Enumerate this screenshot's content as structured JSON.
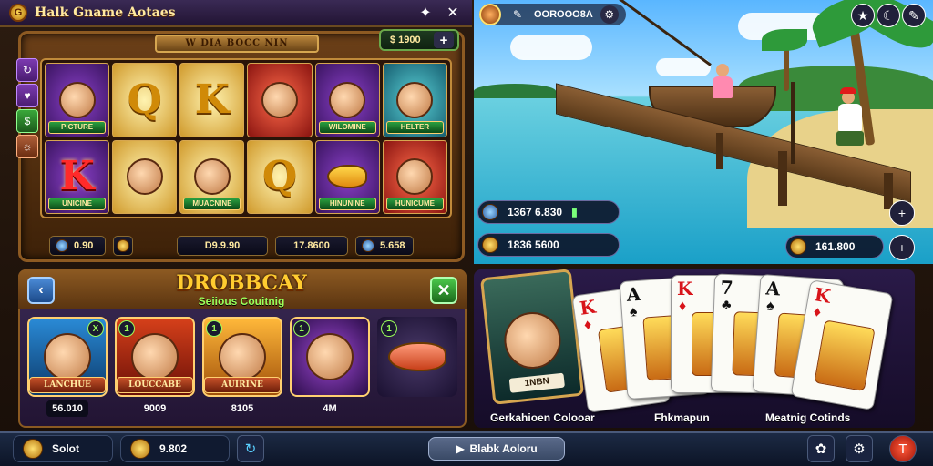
{
  "app": {
    "title": "Halk Gname Aotaes"
  },
  "slot": {
    "banner": "W DIA BOCC NIN",
    "balance": "$ 1900",
    "reels": [
      [
        {
          "type": "face",
          "bg": "purple",
          "tag": "PICTURE"
        },
        {
          "type": "letter",
          "bg": "purple",
          "value": "K",
          "tag": "UNICINE"
        }
      ],
      [
        {
          "type": "letter",
          "bg": "gold",
          "value": "Q",
          "tag": ""
        },
        {
          "type": "face",
          "bg": "gold",
          "tag": ""
        }
      ],
      [
        {
          "type": "letter",
          "bg": "gold",
          "value": "K",
          "tag": ""
        },
        {
          "type": "face",
          "bg": "gold",
          "tag": "MUACNINE"
        }
      ],
      [
        {
          "type": "face",
          "bg": "red",
          "tag": ""
        },
        {
          "type": "letter",
          "bg": "gold",
          "value": "Q",
          "tag": ""
        }
      ],
      [
        {
          "type": "face",
          "bg": "purple",
          "tag": "WILOMINE"
        },
        {
          "type": "fish",
          "bg": "purple",
          "tag": "HINUNINE"
        }
      ],
      [
        {
          "type": "face",
          "bg": "teal",
          "tag": "HELTER"
        },
        {
          "type": "face",
          "bg": "red",
          "tag": "HUNICUME"
        }
      ]
    ],
    "bottom": {
      "bet": "0.90",
      "win": "D9.9.90",
      "total": "17.8600",
      "extra": "5.658"
    }
  },
  "scene": {
    "player_name": "OOROOO8A",
    "pill_1": "1367 6.830",
    "pill_2": "1836 5600",
    "pill_3": "161.800"
  },
  "rewards": {
    "title": "DROBBCAY",
    "subtitle": "Seiious Couitnig",
    "cards": [
      {
        "label": "LANCHUE",
        "price": "56.010",
        "badge": "X",
        "art": "teal"
      },
      {
        "label": "LOUCCABE",
        "price": "9009",
        "badge": "1",
        "art": "red"
      },
      {
        "label": "AUIRINE",
        "price": "8105",
        "badge": "1",
        "art": "gold"
      },
      {
        "label": "",
        "price": "4M",
        "badge": "1",
        "art": "purple"
      },
      {
        "label": "",
        "price": "",
        "badge": "1",
        "art": "fish"
      }
    ]
  },
  "cardtable": {
    "hero_tag": "1NBN",
    "cards": [
      {
        "rank": "K",
        "suit": "♦",
        "color": "red"
      },
      {
        "rank": "A",
        "suit": "♠",
        "color": "black"
      },
      {
        "rank": "K",
        "suit": "♦",
        "color": "red"
      },
      {
        "rank": "7",
        "suit": "♣",
        "color": "black"
      },
      {
        "rank": "A",
        "suit": "♠",
        "color": "black"
      },
      {
        "rank": "K",
        "suit": "♦",
        "color": "red"
      }
    ],
    "captions": [
      "Gerkahioen Colooar",
      "Fhkmapun",
      "Meatnig Cotinds"
    ]
  },
  "bottombar": {
    "left_label": "Solot",
    "coins": "9.802",
    "center_label": "Blabk Aoloru"
  },
  "icons": {
    "logo": "coin-logo-icon",
    "pin": "pin-icon",
    "close": "close-icon"
  }
}
